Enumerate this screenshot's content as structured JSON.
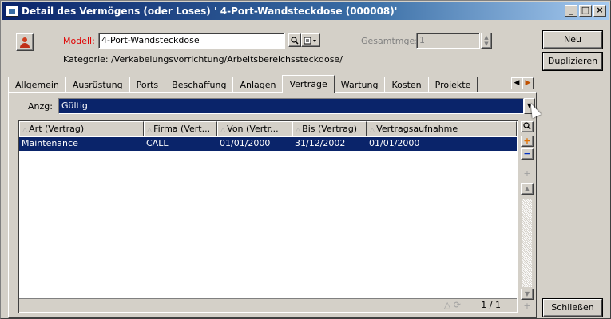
{
  "window": {
    "title": "Detail des Vermögens (oder Loses) ' 4-Port-Wandsteckdose (000008)'",
    "controls": {
      "minimize": "_",
      "maximize": "□",
      "close": "×"
    }
  },
  "header": {
    "model_label": "Modell:",
    "model_value": "4-Port-Wandsteckdose",
    "total_label": "Gesamtmge:",
    "total_value": "1",
    "category_text": "Kategorie: /Verkabelungsvorrichtung/Arbeitsbereichssteckdose/"
  },
  "side_buttons": {
    "new": "Neu",
    "duplicate": "Duplizieren",
    "close": "Schließen"
  },
  "tabs": [
    {
      "label": "Allgemein"
    },
    {
      "label": "Ausrüstung"
    },
    {
      "label": "Ports"
    },
    {
      "label": "Beschaffung"
    },
    {
      "label": "Anlagen"
    },
    {
      "label": "Verträge",
      "active": true
    },
    {
      "label": "Wartung"
    },
    {
      "label": "Kosten"
    },
    {
      "label": "Projekte"
    }
  ],
  "filter": {
    "label": "Anzg:",
    "value": "Gültig"
  },
  "table": {
    "columns": [
      "Art (Vertrag)",
      "Firma (Vert...",
      "Von (Vertr...",
      "Bis (Vertrag)",
      "Vertragsaufnahme"
    ],
    "rows": [
      [
        "Maintenance",
        "CALL",
        "01/01/2000",
        "31/12/2002",
        "01/01/2000"
      ]
    ],
    "pager": "1 / 1"
  },
  "icons": {
    "search": "search-icon",
    "add": "add-icon",
    "remove": "remove-icon"
  },
  "colors": {
    "selection": "#0a246a",
    "title_start": "#0a246a",
    "title_end": "#a6caf0",
    "mandatory_label": "#e00000"
  }
}
